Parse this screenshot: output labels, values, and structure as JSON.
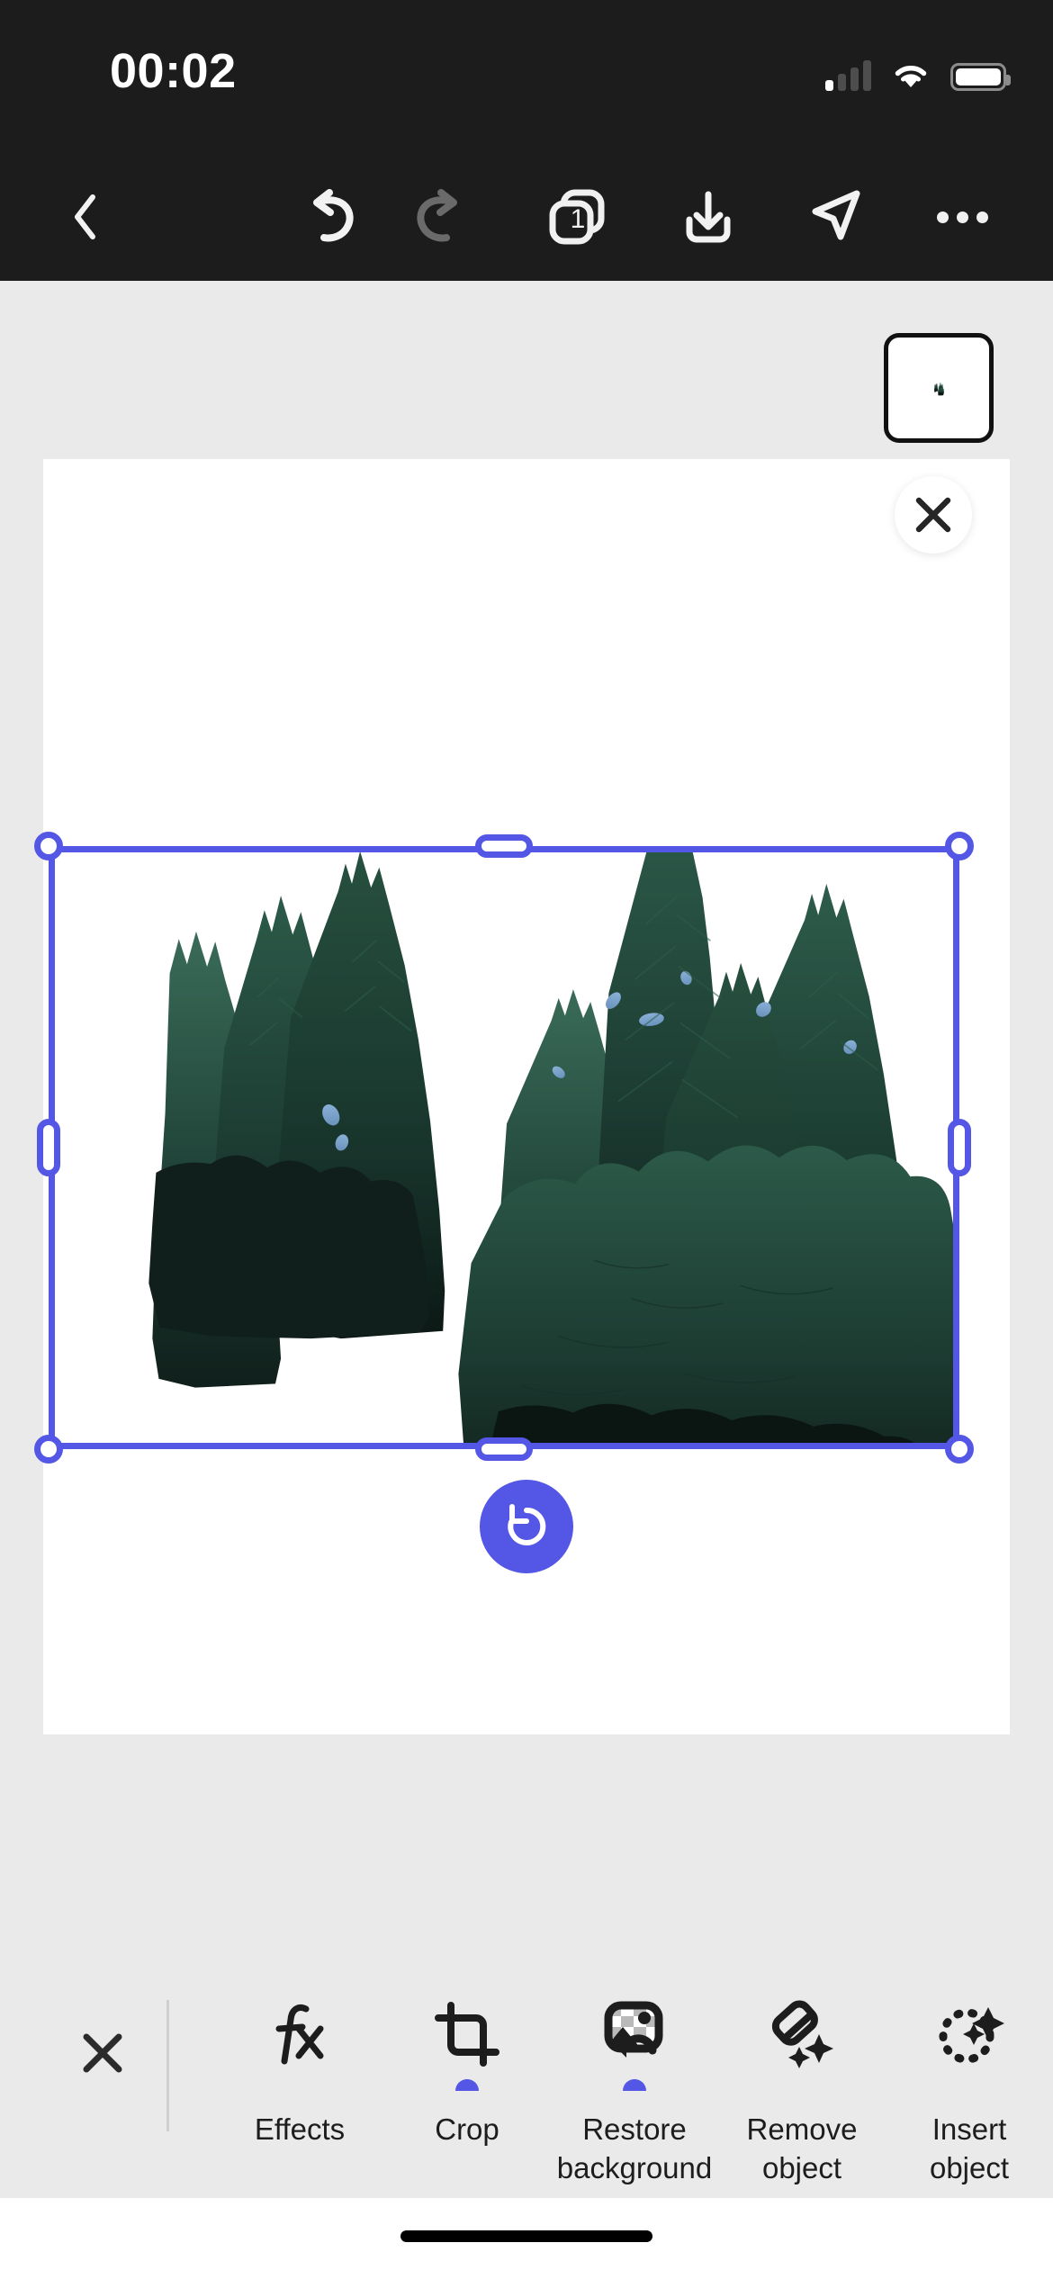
{
  "status_bar": {
    "time": "00:02",
    "cellular_icon": "cellular-signal-icon",
    "cellular_bars_filled": 1,
    "cellular_bars_total": 4,
    "wifi_icon": "wifi-icon",
    "battery_icon": "battery-full-icon",
    "battery_level_pct": 100
  },
  "top_toolbar": {
    "background_color": "#1c1c1c",
    "back_icon": "chevron-left-icon",
    "undo_icon": "undo-arrow-icon",
    "undo_enabled": true,
    "redo_icon": "redo-arrow-icon",
    "redo_enabled": false,
    "layers_icon": "layers-stack-icon",
    "layers_count": "1",
    "save_icon": "download-icon",
    "share_icon": "send-paper-plane-icon",
    "more_icon": "more-horizontal-icon"
  },
  "canvas": {
    "background_color": "#eaeaea",
    "artboard_color": "#ffffff",
    "thumbnail_chip": {
      "name": "layer-thumbnail",
      "selected": true,
      "border_color": "#111111"
    },
    "close_button_icon": "close-x-icon",
    "reset_button_icon": "reset-rotate-ccw-icon",
    "reset_button_color": "#5457e5",
    "selection": {
      "color": "#5457e5",
      "corner_handles": 4,
      "edge_handles": 4
    },
    "artwork": {
      "name": "evergreen-trees-cutout",
      "description": "Cut-out photo of dark evergreen pine trees against sky",
      "colors": {
        "foliage_dark": "#16251f",
        "foliage_mid": "#22453a",
        "foliage_light": "#2f5a4b",
        "sky": "#7fa6cc"
      }
    }
  },
  "bottom_toolbar": {
    "background_color": "#eaeaea",
    "close_icon": "close-x-icon",
    "accent_color": "#5457e5",
    "tools": [
      {
        "label": "Effects",
        "icon": "effects-fx-icon",
        "active_dot": false
      },
      {
        "label": "Crop",
        "icon": "crop-icon",
        "active_dot": true
      },
      {
        "label": "Restore\nbackground",
        "icon": "restore-background-icon",
        "active_dot": true
      },
      {
        "label": "Remove\nobject",
        "icon": "remove-object-eraser-icon",
        "active_dot": false
      },
      {
        "label": "Insert\nobject",
        "icon": "insert-object-icon",
        "active_dot": false
      }
    ]
  },
  "home_indicator": {
    "name": "home-indicator"
  }
}
